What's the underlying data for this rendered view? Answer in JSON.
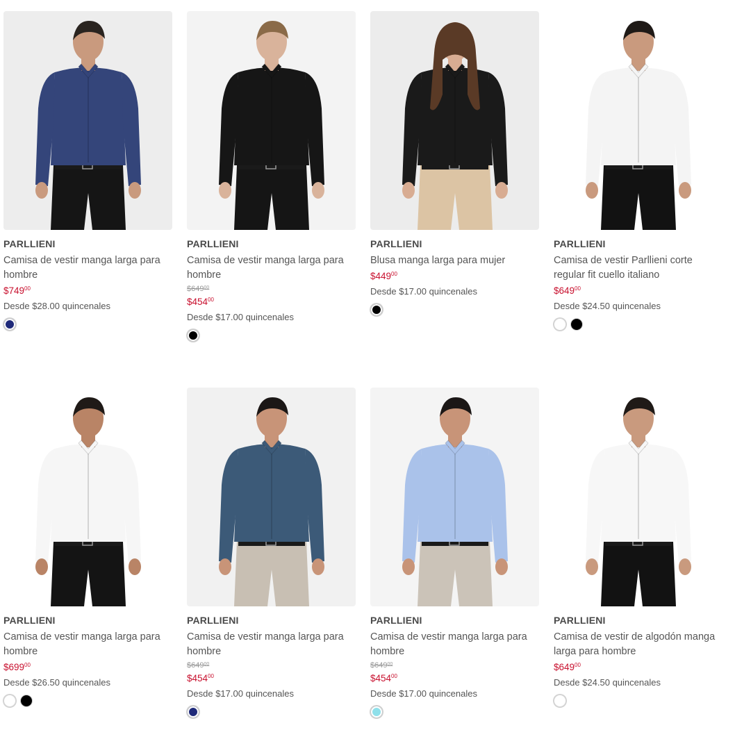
{
  "products": [
    {
      "brand": "PARLLIENI",
      "title": "Camisa de vestir manga larga para hombre",
      "old_price": "",
      "price": "$749",
      "price_cents": "00",
      "installments": "Desde $28.00 quincenales",
      "swatches": [
        "#1f2a7a"
      ],
      "image": {
        "bg": "#ededed",
        "shirt": "#34457a",
        "pants": "#151515",
        "skin": "#c99a7e",
        "hair": "#2a2420",
        "label": "navy-dress-shirt-image"
      }
    },
    {
      "brand": "PARLLIENI",
      "title": "Camisa de vestir manga larga para hombre",
      "old_price": "$649",
      "old_price_cents": "00",
      "price": "$454",
      "price_cents": "00",
      "installments": "Desde $17.00 quincenales",
      "swatches": [
        "#000000"
      ],
      "image": {
        "bg": "#f3f3f3",
        "shirt": "#161616",
        "pants": "#151515",
        "skin": "#d9b39b",
        "hair": "#8a6a48",
        "label": "black-dress-shirt-image"
      }
    },
    {
      "brand": "PARLLIENI",
      "title": "Blusa manga larga para mujer",
      "old_price": "",
      "price": "$449",
      "price_cents": "00",
      "installments": "Desde $17.00 quincenales",
      "swatches": [
        "#000000"
      ],
      "image": {
        "bg": "#ececec",
        "shirt": "#1a1a1a",
        "pants": "#dcc4a4",
        "skin": "#d8ac92",
        "hair": "#5a3a26",
        "label": "black-blouse-image"
      }
    },
    {
      "brand": "PARLLIENI",
      "title": "Camisa de vestir Parllieni corte regular fit cuello italiano",
      "old_price": "",
      "price": "$649",
      "price_cents": "00",
      "installments": "Desde $24.50 quincenales",
      "swatches": [
        "#ffffff",
        "#000000"
      ],
      "image": {
        "bg": "#ffffff",
        "shirt": "#f4f4f4",
        "pants": "#121212",
        "skin": "#c99a7e",
        "hair": "#1f1a17",
        "label": "white-italian-collar-shirt-image"
      }
    },
    {
      "brand": "PARLLIENI",
      "title": "Camisa de vestir manga larga para hombre",
      "old_price": "",
      "price": "$699",
      "price_cents": "00",
      "installments": "Desde $26.50 quincenales",
      "swatches": [
        "#ffffff",
        "#000000"
      ],
      "image": {
        "bg": "#ffffff",
        "shirt": "#f6f6f6",
        "pants": "#141414",
        "skin": "#b98466",
        "hair": "#1f1a17",
        "label": "white-plus-size-shirt-image"
      }
    },
    {
      "brand": "PARLLIENI",
      "title": "Camisa de vestir manga larga para hombre",
      "old_price": "$649",
      "old_price_cents": "00",
      "price": "$454",
      "price_cents": "00",
      "installments": "Desde $17.00 quincenales",
      "swatches": [
        "#1f2a7a"
      ],
      "image": {
        "bg": "#f1f1f1",
        "shirt": "#3c5a78",
        "pants": "#c8bfb3",
        "skin": "#c89478",
        "hair": "#1b1716",
        "label": "blue-patterned-shirt-image"
      }
    },
    {
      "brand": "PARLLIENI",
      "title": "Camisa de vestir manga larga para hombre",
      "old_price": "$649",
      "old_price_cents": "00",
      "price": "$454",
      "price_cents": "00",
      "installments": "Desde $17.00 quincenales",
      "swatches": [
        "#8fe0ea"
      ],
      "image": {
        "bg": "#f4f4f4",
        "shirt": "#aac2ea",
        "pants": "#cbc3b8",
        "skin": "#c89478",
        "hair": "#1b1716",
        "label": "light-blue-shirt-image"
      }
    },
    {
      "brand": "PARLLIENI",
      "title": "Camisa de vestir de algodón manga larga para hombre",
      "old_price": "",
      "price": "$649",
      "price_cents": "00",
      "installments": "Desde $24.50 quincenales",
      "swatches": [
        "#ffffff"
      ],
      "image": {
        "bg": "#ffffff",
        "shirt": "#f7f7f7",
        "pants": "#121212",
        "skin": "#c99a7e",
        "hair": "#1f1a17",
        "label": "white-cotton-shirt-image"
      }
    }
  ]
}
